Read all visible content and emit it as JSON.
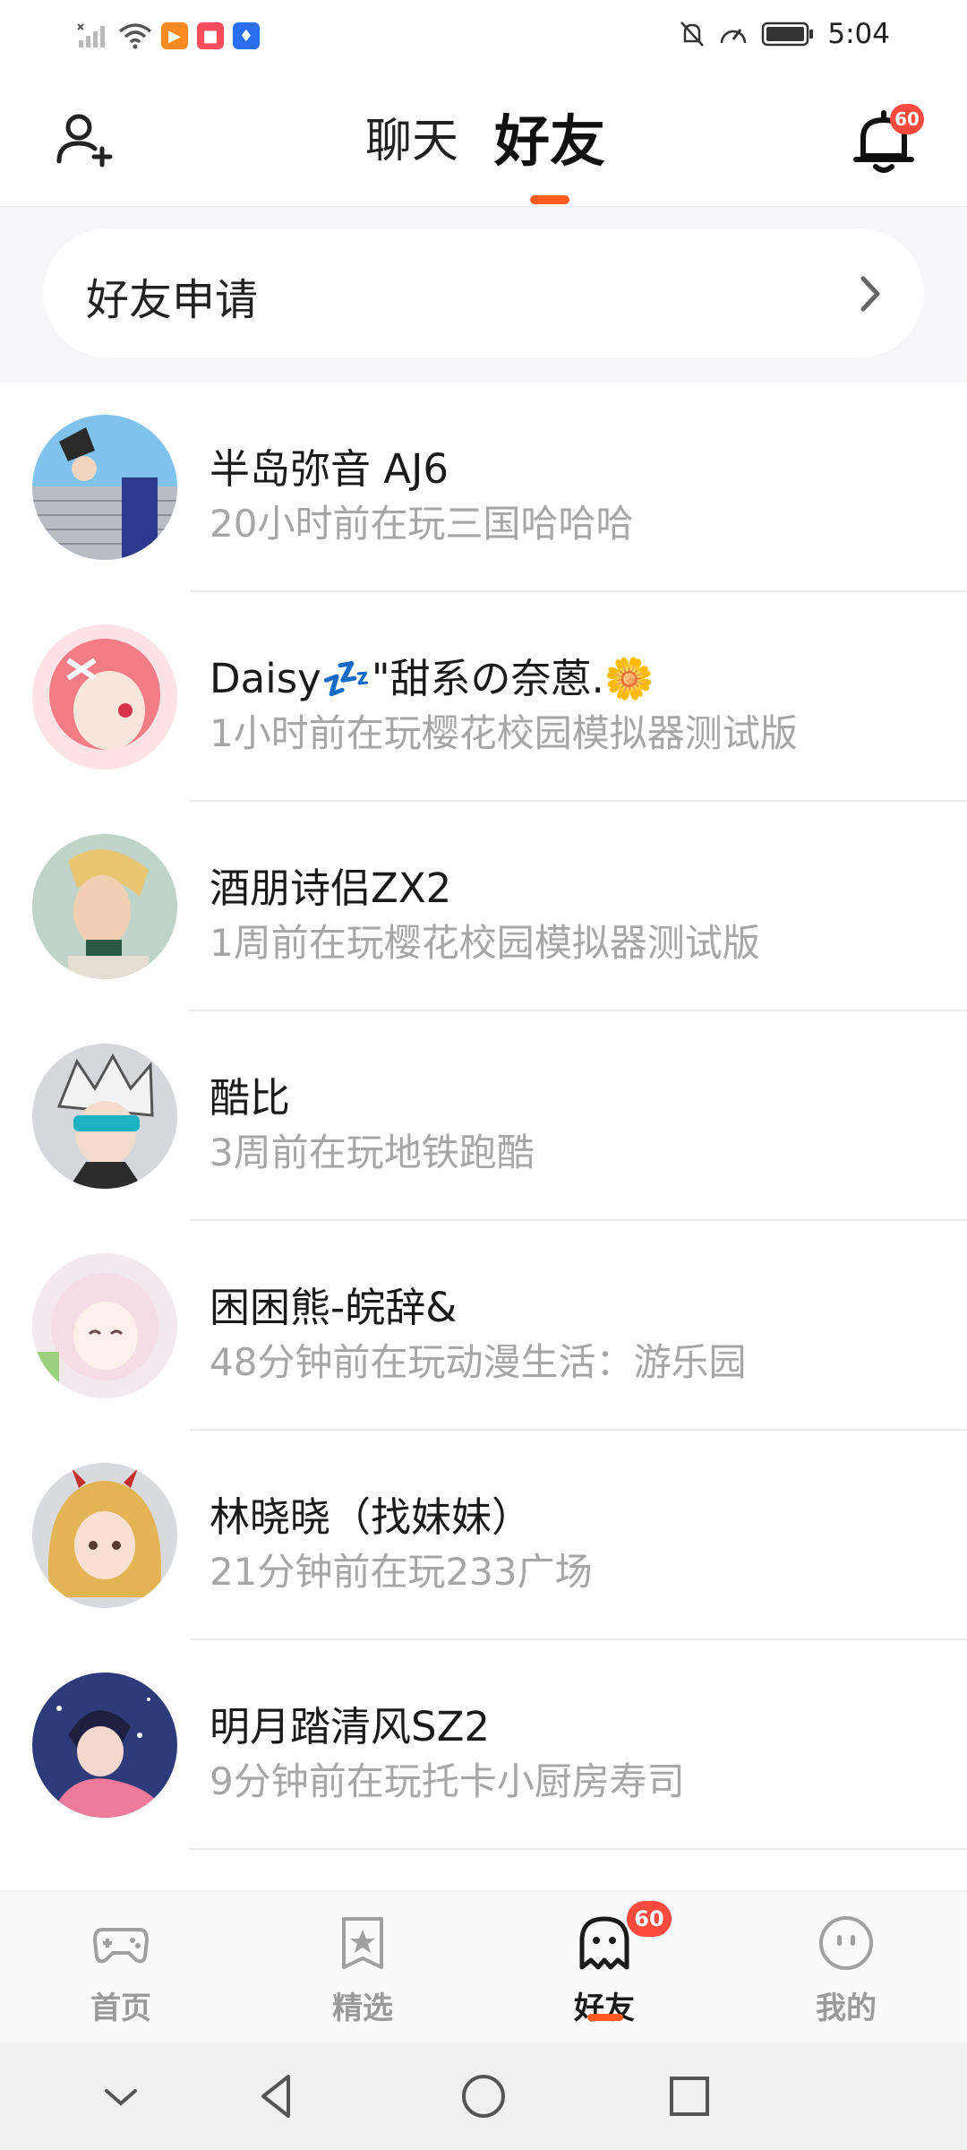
{
  "status_bar": {
    "time": "5:04"
  },
  "header": {
    "tabs": [
      {
        "label": "聊天",
        "active": false
      },
      {
        "label": "好友",
        "active": true
      }
    ],
    "notification_count": "60",
    "accent_color": "#ff5a1f"
  },
  "friend_requests": {
    "label": "好友申请"
  },
  "friends": [
    {
      "name": "半岛弥音 AJ6",
      "status": "20小时前在玩三国哈哈哈"
    },
    {
      "name": "Daisy💤\"甜系の奈蒽.🌼",
      "status": "1小时前在玩樱花校园模拟器测试版"
    },
    {
      "name": "酒朋诗侣ZX2",
      "status": "1周前在玩樱花校园模拟器测试版"
    },
    {
      "name": "酷比",
      "status": "3周前在玩地铁跑酷"
    },
    {
      "name": "困困熊-皖辞&",
      "status": "48分钟前在玩动漫生活：游乐园"
    },
    {
      "name": "林晓晓（找妹妹）",
      "status": "21分钟前在玩233广场"
    },
    {
      "name": "明月踏清风SZ2",
      "status": "9分钟前在玩托卡小厨房寿司"
    }
  ],
  "bottom_nav": {
    "items": [
      {
        "label": "首页",
        "icon": "gamepad-icon"
      },
      {
        "label": "精选",
        "icon": "star-bookmark-icon"
      },
      {
        "label": "好友",
        "icon": "ghost-icon",
        "active": true
      },
      {
        "label": "我的",
        "icon": "smiley-face-icon"
      }
    ],
    "friends_badge": "60"
  }
}
